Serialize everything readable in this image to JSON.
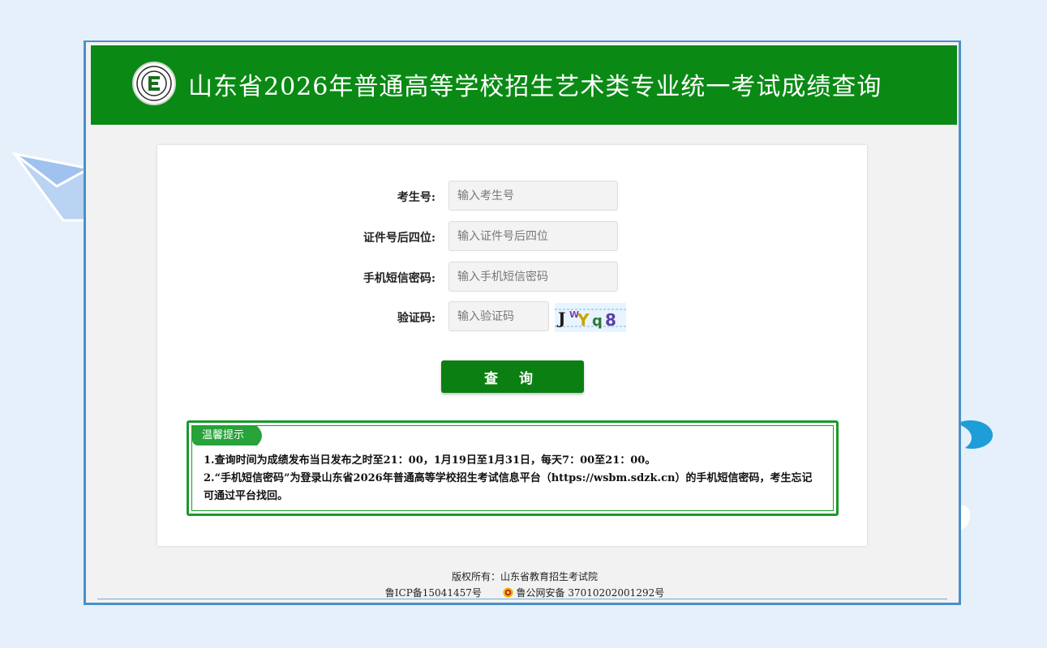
{
  "header": {
    "title": "山东省2026年普通高等学校招生艺术类专业统一考试成绩查询"
  },
  "form": {
    "exam_no": {
      "label": "考生号:",
      "placeholder": "输入考生号",
      "value": ""
    },
    "id_last4": {
      "label": "证件号后四位:",
      "placeholder": "输入证件号后四位",
      "value": ""
    },
    "sms_password": {
      "label": "手机短信密码:",
      "placeholder": "输入手机短信密码",
      "value": ""
    },
    "captcha": {
      "label": "验证码:",
      "placeholder": "输入验证码",
      "value": "",
      "image_text": "JWYq8"
    },
    "submit_label": "查 询"
  },
  "tips": {
    "title": "温馨提示",
    "line1": "1.查询时间为成绩发布当日发布之时至21：00，1月19日至1月31日，每天7：00至21：00。",
    "line2": "2.“手机短信密码”为登录山东省2026年普通高等学校招生考试信息平台（https://wsbm.sdzk.cn）的手机短信密码，考生忘记可通过平台找回。"
  },
  "footer": {
    "copyright": "版权所有：山东省教育招生考试院",
    "icp": "鲁ICP备15041457号",
    "police": "鲁公网安备 37010202001292号"
  },
  "colors": {
    "header_green": "#0a8a14",
    "button_green": "#0c7f12",
    "frame_blue": "#4a90c8",
    "page_bg": "#e6f0fb"
  },
  "icons": [
    "institution-logo",
    "captcha-image",
    "police-badge-icon"
  ]
}
